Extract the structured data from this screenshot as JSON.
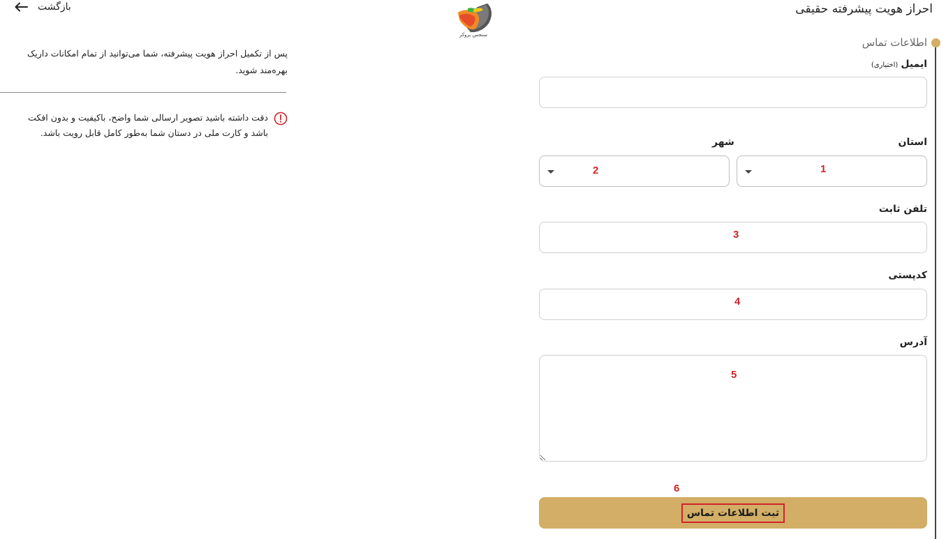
{
  "header": {
    "title": "احراز هویت پیشرفته حقیقی",
    "back_label": "بازگشت",
    "logo_text": "سنجس بروکر"
  },
  "section": {
    "title": "اطلاعات تماس"
  },
  "form": {
    "email_label": "ایمیل",
    "email_optional": "(اختیاری)",
    "province_label": "استان",
    "city_label": "شهر",
    "phone_label": "تلفن ثابت",
    "postal_label": "کدپستی",
    "address_label": "آدرس",
    "submit_label": "ثبت اطلاعات تماس"
  },
  "annotations": {
    "province": "1",
    "city": "2",
    "phone": "3",
    "postal": "4",
    "address": "5",
    "submit": "6"
  },
  "info": {
    "intro": "پس از تکمیل احراز هویت پیشرفته، شما می‌توانید از تمام امکانات داریک بهره‌مند شوید.",
    "warning": "دقت داشته باشید تصویر ارسالی شما واضح، باکیفیت و بدون افکت باشد و کارت ملی در دستان شما به‌طور کامل قابل رویت باشد."
  },
  "colors": {
    "accent": "#d2ae66",
    "annotation": "#d2232a",
    "warning": "#d2232a"
  },
  "icons": {
    "back": "arrow-left-icon",
    "warning": "exclamation-circle-icon",
    "select": "caret-down-icon"
  }
}
